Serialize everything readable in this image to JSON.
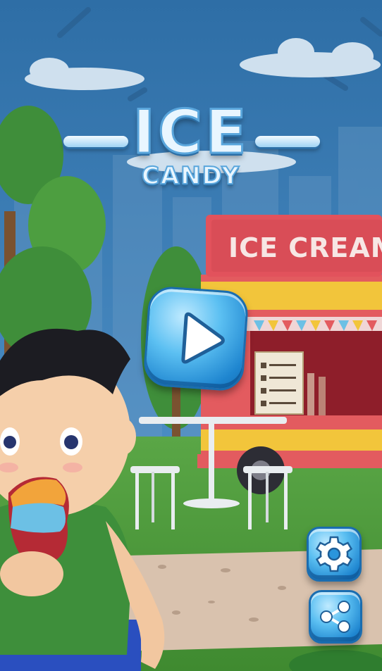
{
  "title": {
    "main": "ICE",
    "sub": "CANDY"
  },
  "scene": {
    "truck_sign": "ICE CREAM"
  },
  "buttons": [
    {
      "id": "play",
      "icon": "play-icon"
    },
    {
      "id": "settings",
      "icon": "gear-icon"
    },
    {
      "id": "share",
      "icon": "share-icon"
    }
  ],
  "colors": {
    "sky": "#3a7bb6",
    "button_blue": "#2a95dc",
    "truck_red": "#e2525c",
    "truck_yellow": "#f2c53b",
    "grass": "#4f9a3a",
    "title_fill": "#e9f6ff"
  }
}
